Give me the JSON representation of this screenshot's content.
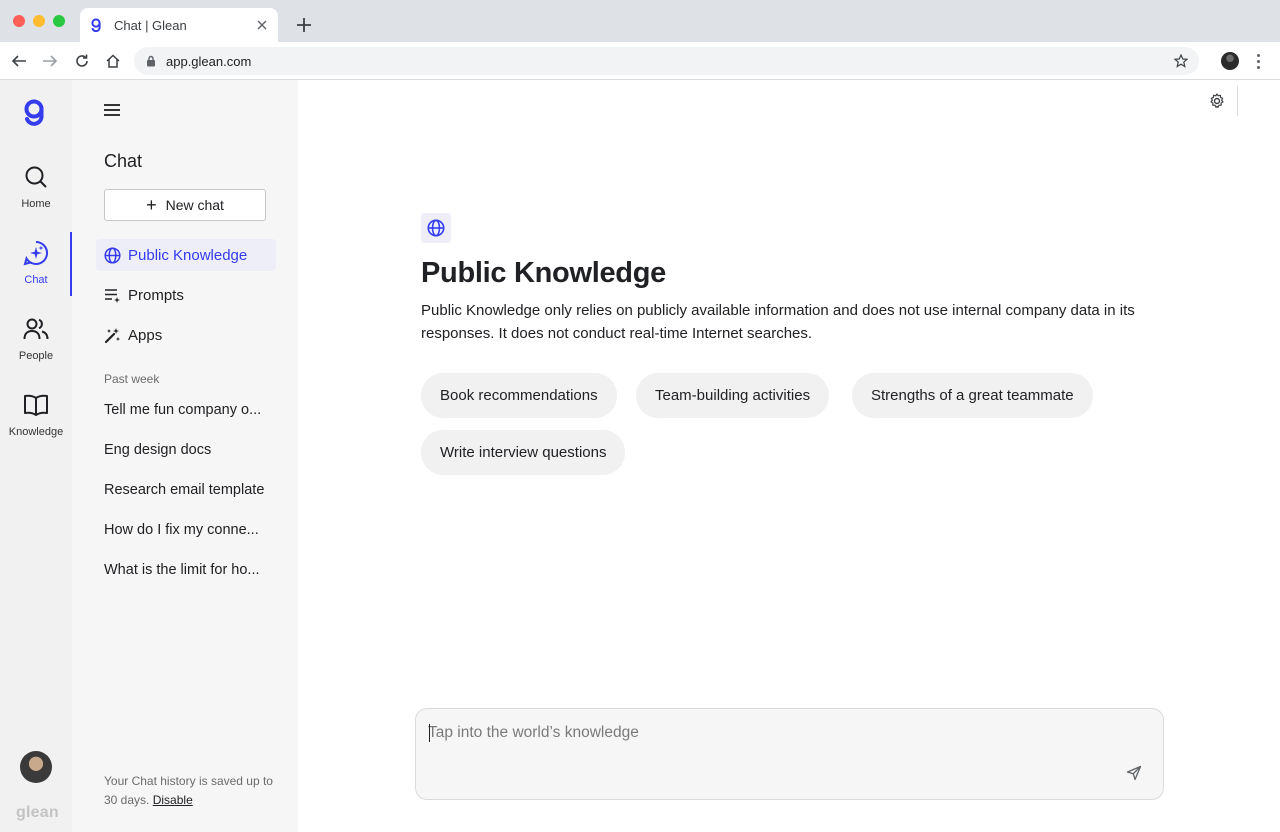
{
  "browser": {
    "tab_title": "Chat | Glean",
    "url": "app.glean.com"
  },
  "rail": {
    "items": [
      {
        "label": "Home",
        "icon": "search-icon"
      },
      {
        "label": "Chat",
        "icon": "chat-sparkle-icon"
      },
      {
        "label": "People",
        "icon": "people-icon"
      },
      {
        "label": "Knowledge",
        "icon": "book-icon"
      }
    ],
    "wordmark": "glean",
    "accent": "#343ced"
  },
  "sidebar": {
    "title": "Chat",
    "new_chat_label": "New chat",
    "nav": [
      {
        "label": "Public Knowledge",
        "icon": "globe-icon"
      },
      {
        "label": "Prompts",
        "icon": "prompts-icon"
      },
      {
        "label": "Apps",
        "icon": "apps-icon"
      }
    ],
    "section_label": "Past week",
    "history": [
      "Tell me fun company o...",
      "Eng design docs",
      "Research email template",
      "How do I fix my conne...",
      "What is the limit for ho..."
    ],
    "footer_text": "Your Chat history is saved up to 30 days.",
    "footer_link": "Disable"
  },
  "main": {
    "title": "Public Knowledge",
    "description": "Public Knowledge only relies on publicly available information and does not use internal company data in its responses. It does not conduct real-time Internet searches.",
    "suggestions": [
      "Book recommendations",
      "Team-building activities",
      "Strengths of a great teammate",
      "Write interview questions"
    ],
    "composer_placeholder": "Tap into the world’s knowledge"
  }
}
